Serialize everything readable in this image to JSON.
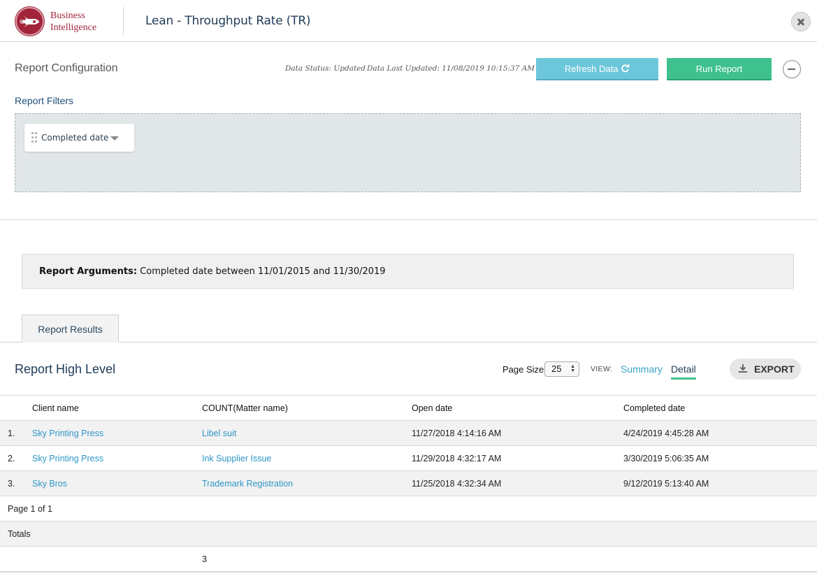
{
  "header": {
    "logo_line1": "Business",
    "logo_line2": "Intelligence",
    "title": "Lean - Throughput Rate (TR)"
  },
  "config": {
    "title": "Report Configuration",
    "data_status": "Data Status: Updated",
    "last_updated": "Data Last Updated: 11/08/2019 10:15:37 AM",
    "refresh_label": "Refresh Data",
    "run_label": "Run Report",
    "filters_label": "Report Filters",
    "filter_chip_label": "Completed date"
  },
  "arguments": {
    "label": "Report Arguments:",
    "text": " Completed date between 11/01/2015 and 11/30/2019"
  },
  "tabs": [
    {
      "label": "Report Results"
    }
  ],
  "results": {
    "title": "Report High Level",
    "page_size_label": "Page Size",
    "page_size_value": "25",
    "view_label": "VIEW:",
    "view_summary": "Summary",
    "view_detail": "Detail",
    "export_label": "EXPORT",
    "columns": [
      "Client name",
      "COUNT(Matter name)",
      "Open date",
      "Completed date"
    ],
    "rows": [
      {
        "num": "1.",
        "client": "Sky Printing Press",
        "matter": "Libel suit",
        "open": "11/27/2018 4:14:16 AM",
        "completed": "4/24/2019 4:45:28 AM"
      },
      {
        "num": "2.",
        "client": "Sky Printing Press",
        "matter": "Ink Supplier Issue",
        "open": "11/29/2018 4:32:17 AM",
        "completed": "3/30/2019 5:06:35 AM"
      },
      {
        "num": "3.",
        "client": "Sky Bros",
        "matter": "Trademark Registration",
        "open": "11/25/2018 4:32:34 AM",
        "completed": "9/12/2019 5:13:40 AM"
      }
    ],
    "pagination": "Page 1 of 1",
    "totals_label": "Totals",
    "totals_count": "3"
  }
}
